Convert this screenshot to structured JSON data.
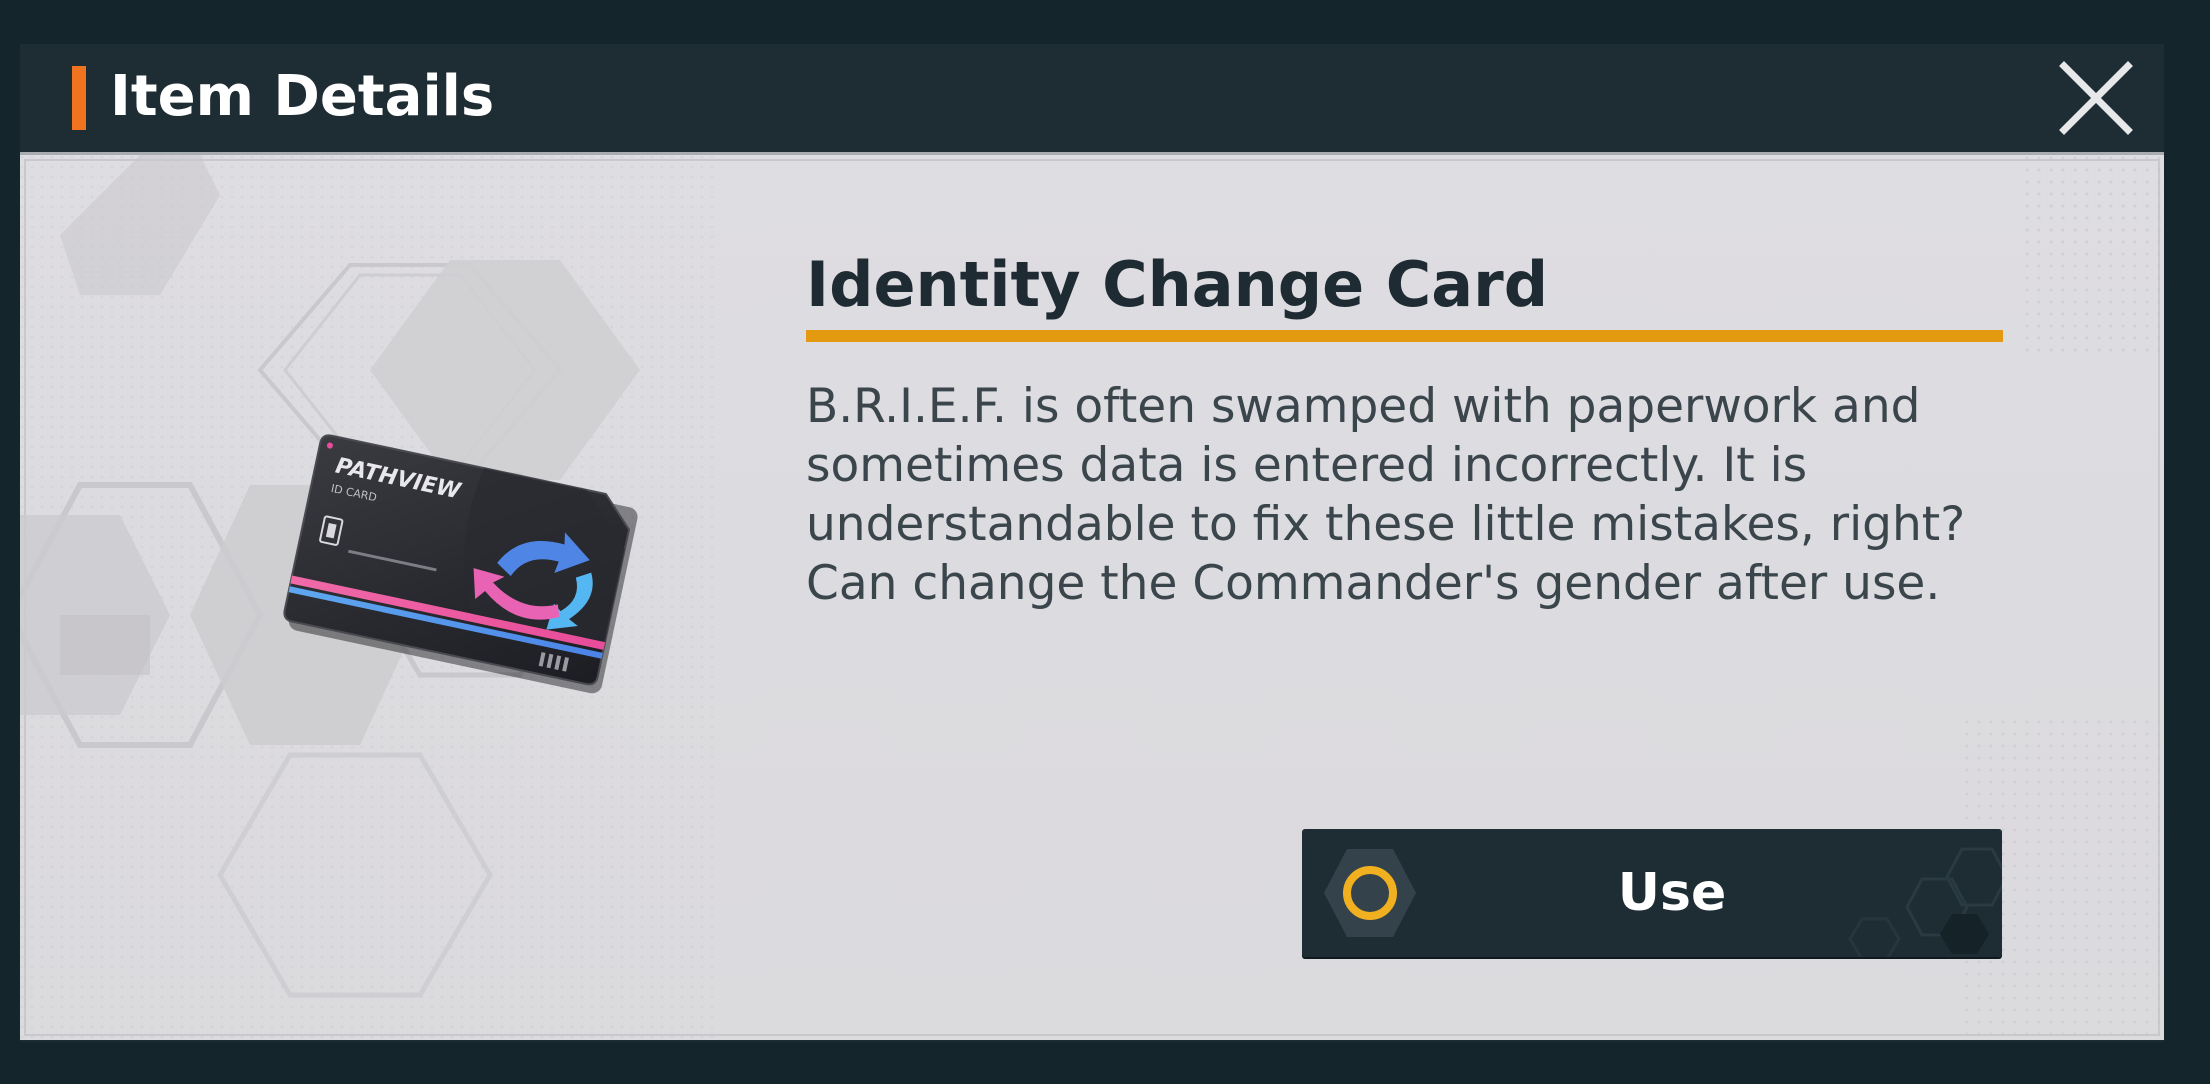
{
  "dialog": {
    "title": "Item Details",
    "accent_color": "#f0731f",
    "close_icon": "close-icon"
  },
  "item": {
    "name": "Identity Change Card",
    "underline_color": "#e39a10",
    "description_lines": [
      "B.R.I.E.F. is often swamped with paperwork and",
      "sometimes data is entered incorrectly. It is",
      "understandable to fix these little mistakes, right?",
      "Can change the Commander's gender after use."
    ],
    "card_text_brand": "PATHVIEW",
    "card_text_sub": "ID CARD",
    "image_icon": "identity-card-icon"
  },
  "actions": {
    "use_label": "Use",
    "use_icon": "circle-hexagon-icon",
    "use_icon_color": "#f0b020"
  }
}
